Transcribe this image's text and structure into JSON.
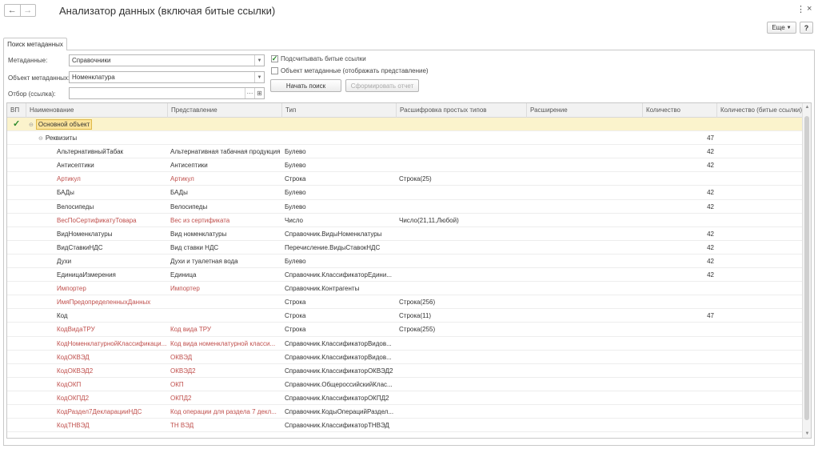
{
  "window": {
    "title": "Анализатор данных (включая битые ссылки)",
    "more_label": "Еще",
    "help_label": "?"
  },
  "tab": {
    "label": "Поиск метаданных"
  },
  "form": {
    "metadata_label": "Метаданные:",
    "metadata_value": "Справочники",
    "object_label": "Объект метаданных:",
    "object_value": "Номенклатура",
    "filter_label": "Отбор (ссылка):",
    "filter_value": "",
    "count_broken_label": "Подсчитывать битые ссылки",
    "count_broken_checked": true,
    "show_repr_label": "Объект метаданные (отображать представление)",
    "show_repr_checked": false,
    "search_button": "Начать поиск",
    "report_button": "Сформировать отчет"
  },
  "table": {
    "columns": [
      "ВП",
      "Наименование",
      "Представление",
      "Тип",
      "Расшифровка простых типов",
      "Расширение",
      "Количество",
      "Количество (битые ссылки)"
    ],
    "root_label": "Основной объект",
    "group_label": "Реквизиты",
    "group_count": "47",
    "rows": [
      {
        "name": "АльтернативныйТабак",
        "repr": "Альтернативная табачная продукция",
        "type": "Булево",
        "detail": "",
        "ext": "",
        "count": "42",
        "broken": "",
        "red": false
      },
      {
        "name": "Антисептики",
        "repr": "Антисептики",
        "type": "Булево",
        "detail": "",
        "ext": "",
        "count": "42",
        "broken": "",
        "red": false
      },
      {
        "name": "Артикул",
        "repr": "Артикул",
        "type": "Строка",
        "detail": "Строка(25)",
        "ext": "",
        "count": "",
        "broken": "",
        "red": true
      },
      {
        "name": "БАДы",
        "repr": "БАДы",
        "type": "Булево",
        "detail": "",
        "ext": "",
        "count": "42",
        "broken": "",
        "red": false
      },
      {
        "name": "Велосипеды",
        "repr": "Велосипеды",
        "type": "Булево",
        "detail": "",
        "ext": "",
        "count": "42",
        "broken": "",
        "red": false
      },
      {
        "name": "ВесПоСертификатуТовара",
        "repr": "Вес из сертификата",
        "type": "Число",
        "detail": "Число(21,11,Любой)",
        "ext": "",
        "count": "",
        "broken": "",
        "red": true
      },
      {
        "name": "ВидНоменклатуры",
        "repr": "Вид номенклатуры",
        "type": "Справочник.ВидыНоменклатуры",
        "detail": "",
        "ext": "",
        "count": "42",
        "broken": "",
        "red": false
      },
      {
        "name": "ВидСтавкиНДС",
        "repr": "Вид ставки НДС",
        "type": "Перечисление.ВидыСтавокНДС",
        "detail": "",
        "ext": "",
        "count": "42",
        "broken": "",
        "red": false
      },
      {
        "name": "Духи",
        "repr": "Духи и туалетная вода",
        "type": "Булево",
        "detail": "",
        "ext": "",
        "count": "42",
        "broken": "",
        "red": false
      },
      {
        "name": "ЕдиницаИзмерения",
        "repr": "Единица",
        "type": "Справочник.КлассификаторЕдини...",
        "detail": "",
        "ext": "",
        "count": "42",
        "broken": "",
        "red": false
      },
      {
        "name": "Импортер",
        "repr": "Импортер",
        "type": "Справочник.Контрагенты",
        "detail": "",
        "ext": "",
        "count": "",
        "broken": "",
        "red": true
      },
      {
        "name": "ИмяПредопределенныхДанных",
        "repr": "",
        "type": "Строка",
        "detail": "Строка(256)",
        "ext": "",
        "count": "",
        "broken": "",
        "red": true
      },
      {
        "name": "Код",
        "repr": "",
        "type": "Строка",
        "detail": "Строка(11)",
        "ext": "",
        "count": "47",
        "broken": "",
        "red": false
      },
      {
        "name": "КодВидаТРУ",
        "repr": "Код вида ТРУ",
        "type": "Строка",
        "detail": "Строка(255)",
        "ext": "",
        "count": "",
        "broken": "",
        "red": true
      },
      {
        "name": "КодНоменклатурнойКлассификаци...",
        "repr": "Код вида номенклатурной класси...",
        "type": "Справочник.КлассификаторВидов...",
        "detail": "",
        "ext": "",
        "count": "",
        "broken": "",
        "red": true
      },
      {
        "name": "КодОКВЭД",
        "repr": "ОКВЭД",
        "type": "Справочник.КлассификаторВидов...",
        "detail": "",
        "ext": "",
        "count": "",
        "broken": "",
        "red": true
      },
      {
        "name": "КодОКВЭД2",
        "repr": "ОКВЭД2",
        "type": "Справочник.КлассификаторОКВЭД2",
        "detail": "",
        "ext": "",
        "count": "",
        "broken": "",
        "red": true
      },
      {
        "name": "КодОКП",
        "repr": "ОКП",
        "type": "Справочник.ОбщероссийскийКлас...",
        "detail": "",
        "ext": "",
        "count": "",
        "broken": "",
        "red": true
      },
      {
        "name": "КодОКПД2",
        "repr": "ОКПД2",
        "type": "Справочник.КлассификаторОКПД2",
        "detail": "",
        "ext": "",
        "count": "",
        "broken": "",
        "red": true
      },
      {
        "name": "КодРаздел7ДекларацииНДС",
        "repr": "Код операции для раздела 7 декл...",
        "type": "Справочник.КодыОперацийРаздел...",
        "detail": "",
        "ext": "",
        "count": "",
        "broken": "",
        "red": true
      },
      {
        "name": "КодТНВЭД",
        "repr": "ТН ВЭД",
        "type": "Справочник.КлассификаторТНВЭД",
        "detail": "",
        "ext": "",
        "count": "",
        "broken": "",
        "red": true
      }
    ]
  },
  "colors": {
    "error_text": "#c0504d",
    "selection_row": "#fbf3cc",
    "checkmark": "#2a8a2a"
  }
}
